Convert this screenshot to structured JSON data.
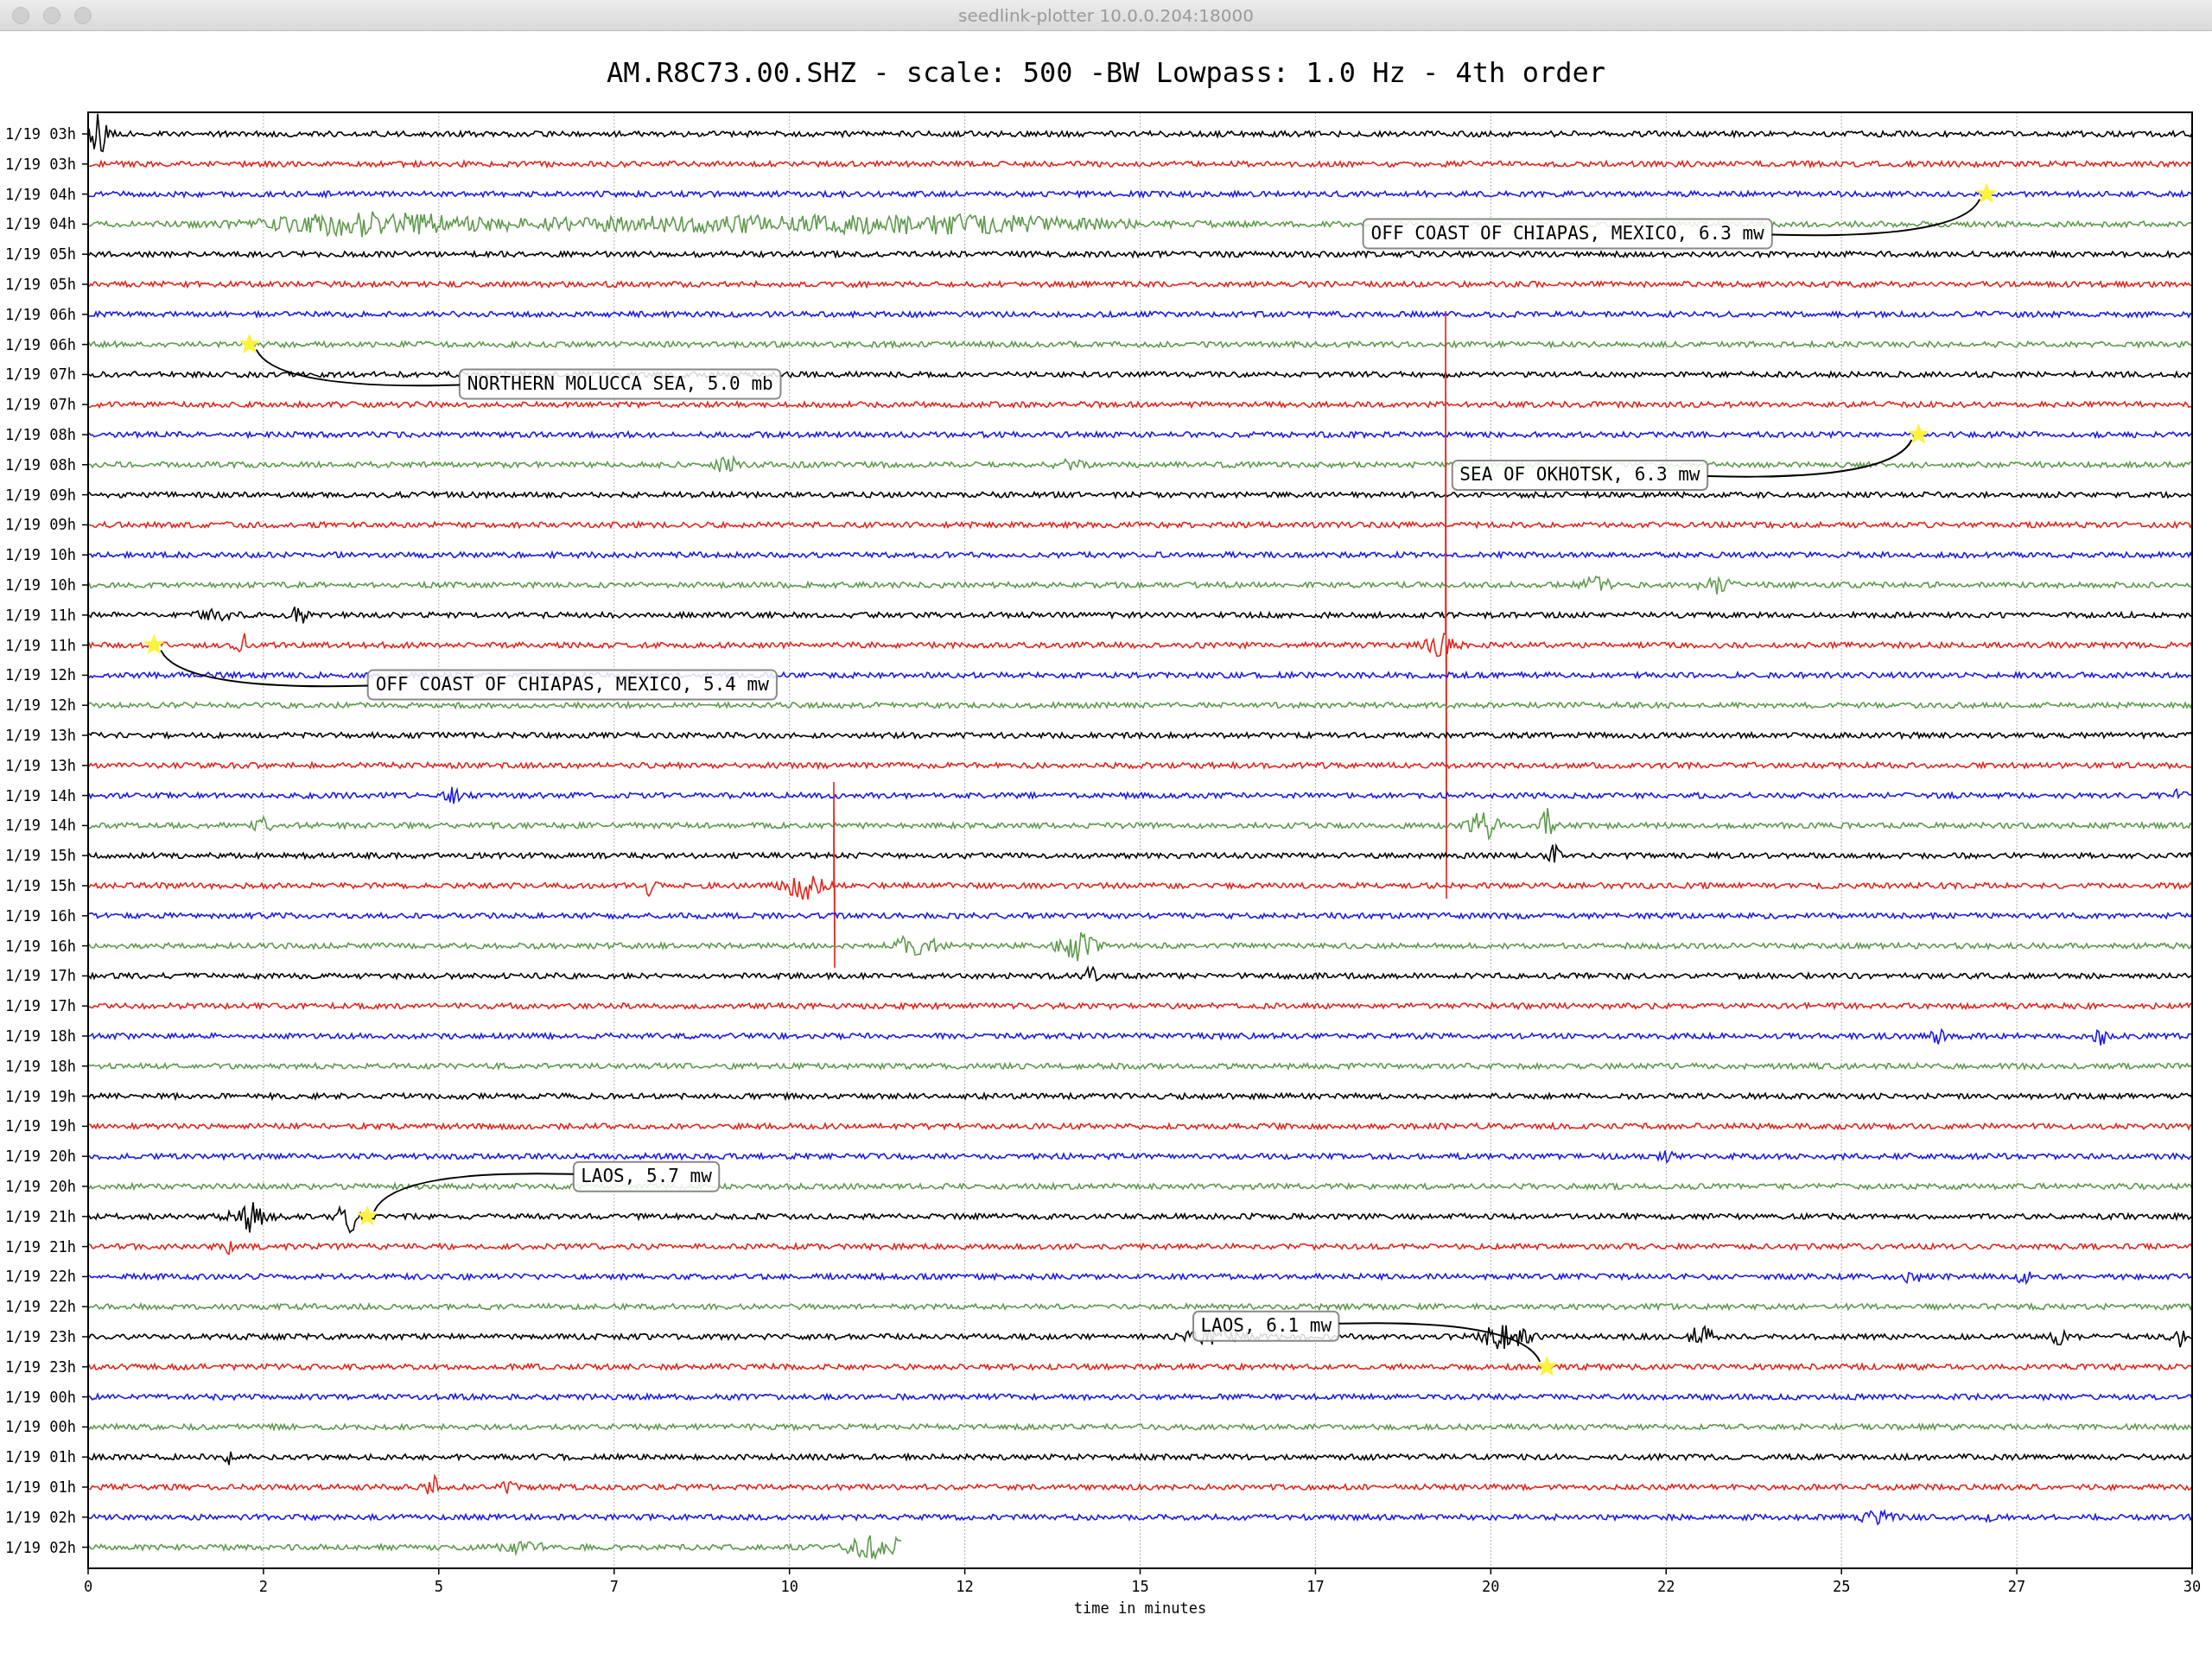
{
  "window": {
    "title": "seedlink-plotter 10.0.0.204:18000"
  },
  "plot": {
    "title": "AM.R8C73.00.SHZ - scale: 500 -BW Lowpass: 1.0 Hz - 4th order",
    "traces": [
      {
        "label": "1/19 03h",
        "color": "#000000"
      },
      {
        "label": "1/19 03h",
        "color": "#e3261c"
      },
      {
        "label": "1/19 04h",
        "color": "#1b1bee"
      },
      {
        "label": "1/19 04h",
        "color": "#5e9a4c"
      },
      {
        "label": "1/19 05h",
        "color": "#000000"
      },
      {
        "label": "1/19 05h",
        "color": "#e3261c"
      },
      {
        "label": "1/19 06h",
        "color": "#1b1bee"
      },
      {
        "label": "1/19 06h",
        "color": "#5e9a4c"
      },
      {
        "label": "1/19 07h",
        "color": "#000000"
      },
      {
        "label": "1/19 07h",
        "color": "#e3261c"
      },
      {
        "label": "1/19 08h",
        "color": "#1b1bee"
      },
      {
        "label": "1/19 08h",
        "color": "#5e9a4c"
      },
      {
        "label": "1/19 09h",
        "color": "#000000"
      },
      {
        "label": "1/19 09h",
        "color": "#e3261c"
      },
      {
        "label": "1/19 10h",
        "color": "#1b1bee"
      },
      {
        "label": "1/19 10h",
        "color": "#5e9a4c"
      },
      {
        "label": "1/19 11h",
        "color": "#000000"
      },
      {
        "label": "1/19 11h",
        "color": "#e3261c"
      },
      {
        "label": "1/19 12h",
        "color": "#1b1bee"
      },
      {
        "label": "1/19 12h",
        "color": "#5e9a4c"
      },
      {
        "label": "1/19 13h",
        "color": "#000000"
      },
      {
        "label": "1/19 13h",
        "color": "#e3261c"
      },
      {
        "label": "1/19 14h",
        "color": "#1b1bee"
      },
      {
        "label": "1/19 14h",
        "color": "#5e9a4c"
      },
      {
        "label": "1/19 15h",
        "color": "#000000"
      },
      {
        "label": "1/19 15h",
        "color": "#e3261c"
      },
      {
        "label": "1/19 16h",
        "color": "#1b1bee"
      },
      {
        "label": "1/19 16h",
        "color": "#5e9a4c"
      },
      {
        "label": "1/19 17h",
        "color": "#000000"
      },
      {
        "label": "1/19 17h",
        "color": "#e3261c"
      },
      {
        "label": "1/19 18h",
        "color": "#1b1bee"
      },
      {
        "label": "1/19 18h",
        "color": "#5e9a4c"
      },
      {
        "label": "1/19 19h",
        "color": "#000000"
      },
      {
        "label": "1/19 19h",
        "color": "#e3261c"
      },
      {
        "label": "1/19 20h",
        "color": "#1b1bee"
      },
      {
        "label": "1/19 20h",
        "color": "#5e9a4c"
      },
      {
        "label": "1/19 21h",
        "color": "#000000"
      },
      {
        "label": "1/19 21h",
        "color": "#e3261c"
      },
      {
        "label": "1/19 22h",
        "color": "#1b1bee"
      },
      {
        "label": "1/19 22h",
        "color": "#5e9a4c"
      },
      {
        "label": "1/19 23h",
        "color": "#000000"
      },
      {
        "label": "1/19 23h",
        "color": "#e3261c"
      },
      {
        "label": "1/19 00h",
        "color": "#1b1bee"
      },
      {
        "label": "1/19 00h",
        "color": "#5e9a4c"
      },
      {
        "label": "1/19 01h",
        "color": "#000000"
      },
      {
        "label": "1/19 01h",
        "color": "#e3261c"
      },
      {
        "label": "1/19 02h",
        "color": "#1b1bee"
      },
      {
        "label": "1/19 02h",
        "color": "#5e9a4c"
      }
    ],
    "x_axis": {
      "ticks": [
        "0",
        "2",
        "5",
        "7",
        "10",
        "12",
        "15",
        "17",
        "20",
        "22",
        "25",
        "27",
        "30"
      ],
      "label": "time in minutes"
    },
    "events": [
      {
        "text": "OFF COAST OF CHIAPAS, MEXICO, 6.3 mw"
      },
      {
        "text": "NORTHERN MOLUCCA SEA, 5.0 mb"
      },
      {
        "text": "SEA OF OKHOTSK, 6.3 mw"
      },
      {
        "text": "OFF COAST OF CHIAPAS, MEXICO, 5.4 mw"
      },
      {
        "text": "LAOS, 5.7 mw"
      },
      {
        "text": "LAOS, 6.1 mw"
      }
    ]
  }
}
